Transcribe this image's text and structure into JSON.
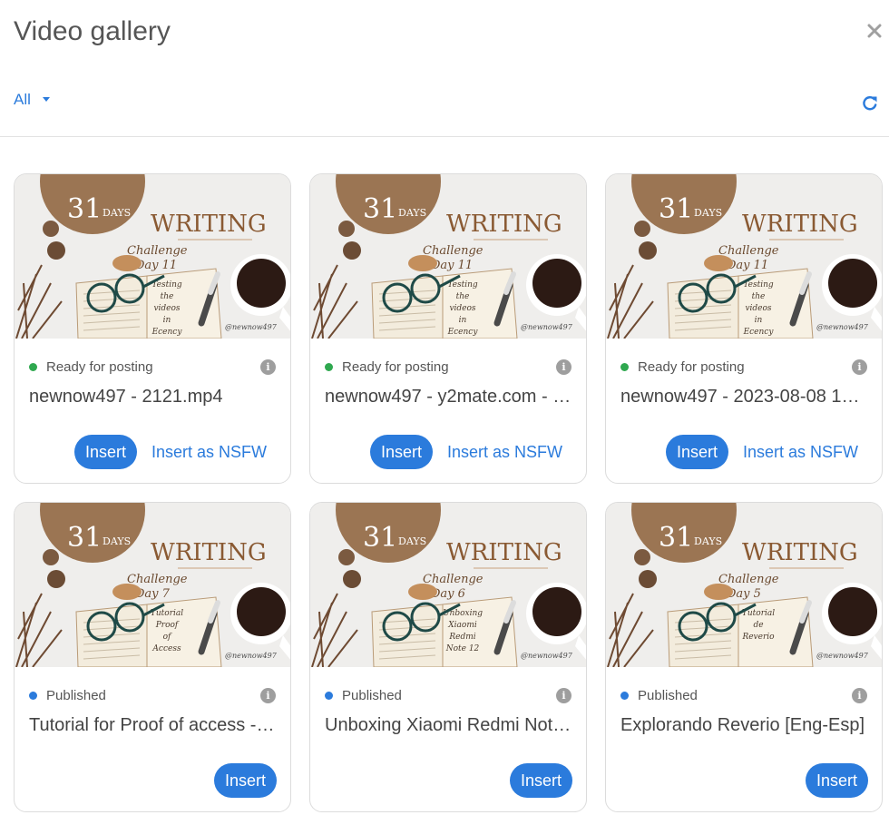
{
  "header": {
    "title": "Video gallery",
    "filter_label": "All"
  },
  "colors": {
    "accent": "#2b7bdc",
    "ready": "#2fa84f",
    "published": "#2b7bdc"
  },
  "labels": {
    "insert": "Insert",
    "insert_nsfw": "Insert as NSFW"
  },
  "videos": [
    {
      "status": "Ready for posting",
      "status_type": "ready",
      "name": "newnow497 - 2121.mp4",
      "thumb": {
        "number": "31",
        "days": "DAYS",
        "word": "WRITING",
        "challenge": "Challenge",
        "day": "Day 11",
        "page_lines": [
          "Testing",
          "the",
          "videos",
          "in",
          "Ecency"
        ],
        "credit": "@newnow497"
      }
    },
    {
      "status": "Ready for posting",
      "status_type": "ready",
      "name": "newnow497 - y2mate.com - …",
      "thumb": {
        "number": "31",
        "days": "DAYS",
        "word": "WRITING",
        "challenge": "Challenge",
        "day": "Day 11",
        "page_lines": [
          "Testing",
          "the",
          "videos",
          "in",
          "Ecency"
        ],
        "credit": "@newnow497"
      }
    },
    {
      "status": "Ready for posting",
      "status_type": "ready",
      "name": "newnow497 - 2023-08-08 1…",
      "thumb": {
        "number": "31",
        "days": "DAYS",
        "word": "WRITING",
        "challenge": "Challenge",
        "day": "Day 11",
        "page_lines": [
          "Testing",
          "the",
          "videos",
          "in",
          "Ecency"
        ],
        "credit": "@newnow497"
      }
    },
    {
      "status": "Published",
      "status_type": "published",
      "name": "Tutorial for Proof of access -…",
      "thumb": {
        "number": "31",
        "days": "DAYS",
        "word": "WRITING",
        "challenge": "Challenge",
        "day": "Day 7",
        "page_lines": [
          "Tutorial",
          "Proof",
          "of",
          "Access"
        ],
        "credit": "@newnow497"
      }
    },
    {
      "status": "Published",
      "status_type": "published",
      "name": "Unboxing Xiaomi Redmi Not…",
      "thumb": {
        "number": "31",
        "days": "DAYS",
        "word": "WRITING",
        "challenge": "Challenge",
        "day": "Day 6",
        "page_lines": [
          "Unboxing",
          "Xiaomi",
          "Redmi",
          "Note 12"
        ],
        "credit": "@newnow497"
      }
    },
    {
      "status": "Published",
      "status_type": "published",
      "name": "Explorando Reverio [Eng-Esp]",
      "thumb": {
        "number": "31",
        "days": "DAYS",
        "word": "WRITING",
        "challenge": "Challenge",
        "day": "Day 5",
        "page_lines": [
          "Tutorial",
          "de",
          "Reverio"
        ],
        "credit": "@newnow497"
      }
    }
  ]
}
